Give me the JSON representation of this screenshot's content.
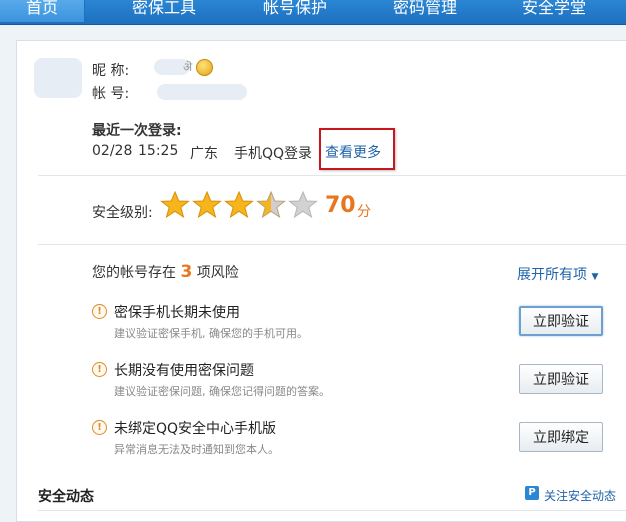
{
  "nav": {
    "items": [
      {
        "label": "首页",
        "active": true
      },
      {
        "label": "密保工具"
      },
      {
        "label": "帐号保护"
      },
      {
        "label": "密码管理"
      },
      {
        "label": "安全学堂"
      }
    ]
  },
  "profile": {
    "nickname_label": "昵    称:",
    "account_label": "帐    号:",
    "nickname_tail": "ऄ"
  },
  "last_login": {
    "heading": "最近一次登录:",
    "date": "02/28",
    "time": "15:25",
    "location": "广东",
    "device": "手机QQ登录",
    "more_link": "查看更多"
  },
  "security": {
    "level_label": "安全级别:",
    "stars_filled": 3.5,
    "stars_total": 5,
    "score": "70",
    "score_unit": "分"
  },
  "risk": {
    "prefix": "您的帐号存在",
    "count": "3",
    "suffix": "项风险",
    "expand_label": "展开所有项",
    "items": [
      {
        "title": "密保手机长期未使用",
        "desc": "建议验证密保手机, 确保您的手机可用。",
        "action": "立即验证"
      },
      {
        "title": "长期没有使用密保问题",
        "desc": "建议验证密保问题, 确保您记得问题的答案。",
        "action": "立即验证"
      },
      {
        "title": "未绑定QQ安全中心手机版",
        "desc": "异常消息无法及时通知到您本人。",
        "action": "立即绑定"
      }
    ]
  },
  "feed": {
    "title": "安全动态",
    "follow_label": "关注安全动态"
  },
  "colors": {
    "nav_blue": "#1d6fc0",
    "accent_orange": "#e8761f",
    "link_blue": "#1f63a8",
    "highlight_red": "#c8161d"
  }
}
